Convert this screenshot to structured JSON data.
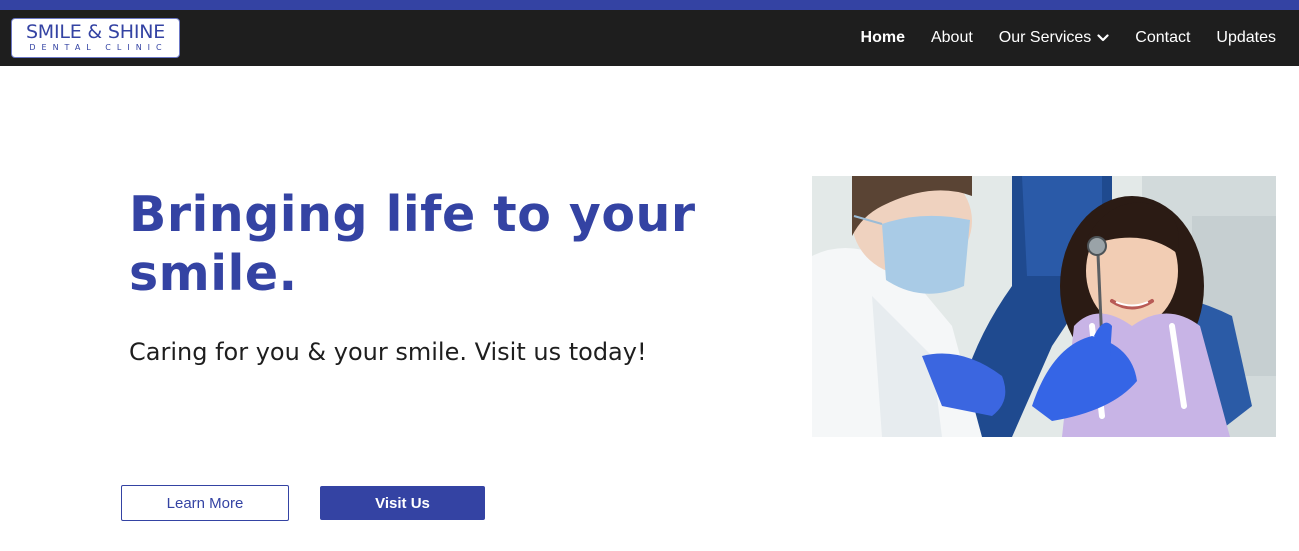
{
  "brand": {
    "name": "SMILE & SHINE",
    "tagline": "DENTAL CLINIC"
  },
  "nav": {
    "items": [
      {
        "label": "Home",
        "active": true
      },
      {
        "label": "About"
      },
      {
        "label": "Our Services",
        "icon": "chevron-down-icon"
      },
      {
        "label": "Contact"
      },
      {
        "label": "Updates"
      }
    ]
  },
  "hero": {
    "title": "Bringing life to your smile.",
    "subtitle": "Caring for you & your smile. Visit us today!",
    "image_icon": "dentist-child-photo"
  },
  "buttons": {
    "learn_more": "Learn More",
    "visit_us": "Visit Us"
  },
  "colors": {
    "accent": "#3443a3",
    "nav_background": "#1e1e1e",
    "text": "#1e1e1e"
  }
}
